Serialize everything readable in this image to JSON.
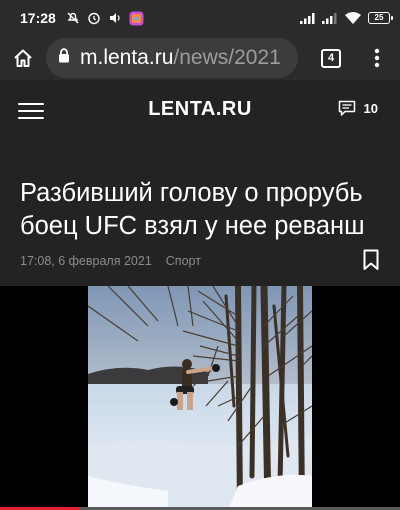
{
  "status_bar": {
    "time": "17:28",
    "battery": "25"
  },
  "browser": {
    "url_domain": "m.lenta.ru",
    "url_path": "/news/2021",
    "tab_count": "4"
  },
  "site": {
    "logo": "LENTA.RU",
    "comment_count": "10"
  },
  "article": {
    "title": "Разбивший голову о прорубь боец UFC взял у нее реванш",
    "date": "17:08, 6 февраля 2021",
    "category": "Спорт"
  },
  "video": {
    "progress": 0.2,
    "progress_color": "#e0202a"
  },
  "icons": [
    "no-disturb-icon",
    "alarm-icon",
    "volume-icon",
    "app-icon",
    "signal-icon",
    "wifi-icon",
    "battery-icon",
    "home-icon",
    "lock-icon",
    "more-vert-icon",
    "menu-icon",
    "comment-icon",
    "bookmark-icon"
  ]
}
